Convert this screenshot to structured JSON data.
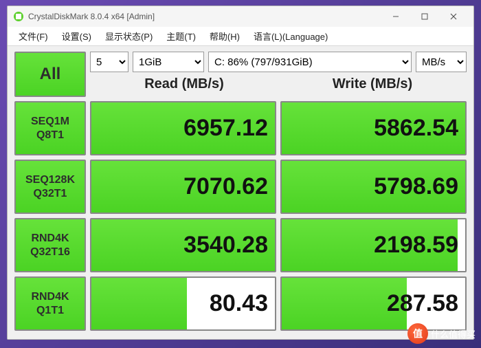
{
  "window": {
    "title": "CrystalDiskMark 8.0.4 x64 [Admin]"
  },
  "menu": {
    "file": "文件(F)",
    "settings": "设置(S)",
    "display": "显示状态(P)",
    "theme": "主题(T)",
    "help": "帮助(H)",
    "language": "语言(L)(Language)"
  },
  "controls": {
    "all_label": "All",
    "loops": "5",
    "size": "1GiB",
    "drive": "C: 86% (797/931GiB)",
    "unit": "MB/s"
  },
  "headers": {
    "read": "Read (MB/s)",
    "write": "Write (MB/s)"
  },
  "tests": [
    {
      "line1": "SEQ1M",
      "line2": "Q8T1",
      "read": "6957.12",
      "write": "5862.54",
      "read_pct": 100,
      "write_pct": 100
    },
    {
      "line1": "SEQ128K",
      "line2": "Q32T1",
      "read": "7070.62",
      "write": "5798.69",
      "read_pct": 100,
      "write_pct": 100
    },
    {
      "line1": "RND4K",
      "line2": "Q32T16",
      "read": "3540.28",
      "write": "2198.59",
      "read_pct": 100,
      "write_pct": 96
    },
    {
      "line1": "RND4K",
      "line2": "Q1T1",
      "read": "80.43",
      "write": "287.58",
      "read_pct": 52,
      "write_pct": 68
    }
  ],
  "watermark": {
    "glyph": "值",
    "text": "什么值得买"
  }
}
